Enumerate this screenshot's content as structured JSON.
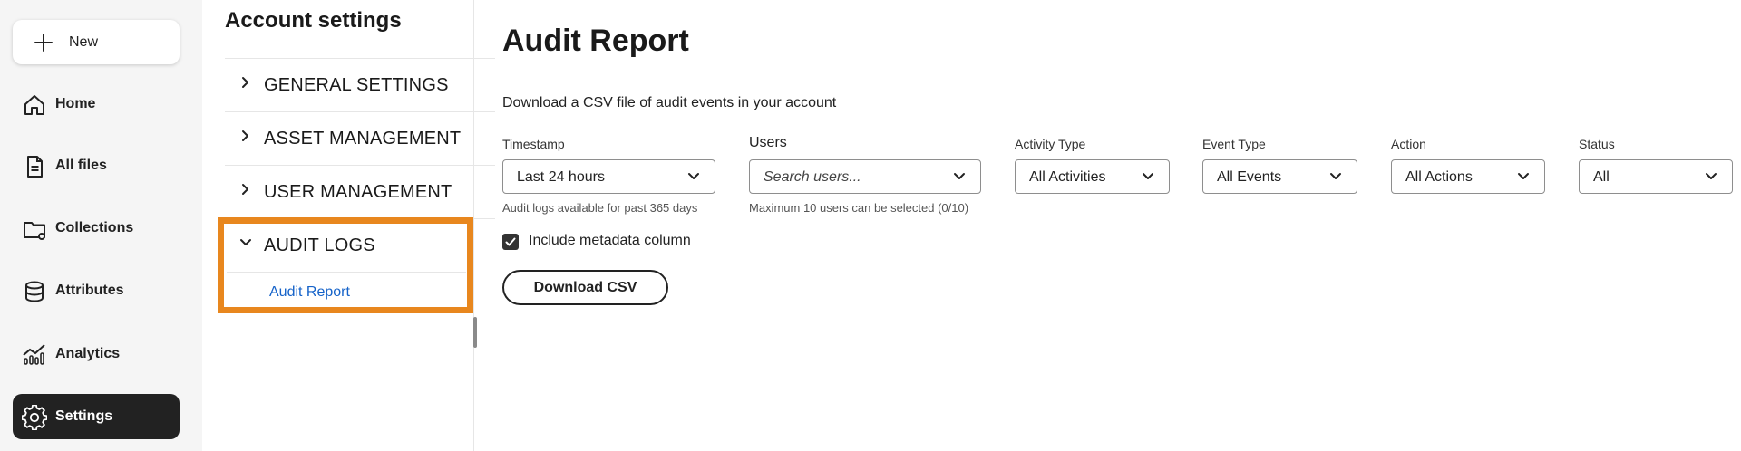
{
  "sidebar": {
    "new_label": "New",
    "items": [
      {
        "label": "Home",
        "icon": "home-icon"
      },
      {
        "label": "All files",
        "icon": "file-icon"
      },
      {
        "label": "Collections",
        "icon": "collections-folder-icon"
      },
      {
        "label": "Attributes",
        "icon": "database-icon"
      },
      {
        "label": "Analytics",
        "icon": "analytics-chart-icon"
      },
      {
        "label": "Settings",
        "icon": "gear-icon",
        "active": true
      }
    ]
  },
  "settings_panel": {
    "title": "Account settings",
    "sections": [
      {
        "label": "GENERAL SETTINGS",
        "expanded": false
      },
      {
        "label": "ASSET MANAGEMENT",
        "expanded": false
      },
      {
        "label": "USER MANAGEMENT",
        "expanded": false
      },
      {
        "label": "AUDIT LOGS",
        "expanded": true,
        "children": [
          "Audit Report"
        ]
      }
    ],
    "highlight_color": "#e8871e"
  },
  "main": {
    "title": "Audit Report",
    "description": "Download a CSV file of audit events in your account",
    "filters": {
      "timestamp": {
        "label": "Timestamp",
        "value": "Last 24 hours",
        "hint": "Audit logs available for past 365 days"
      },
      "users": {
        "label": "Users",
        "placeholder": "Search users...",
        "hint": "Maximum 10 users can be selected (0/10)"
      },
      "activity_type": {
        "label": "Activity Type",
        "value": "All Activities"
      },
      "event_type": {
        "label": "Event Type",
        "value": "All Events"
      },
      "action": {
        "label": "Action",
        "value": "All Actions"
      },
      "status": {
        "label": "Status",
        "value": "All"
      }
    },
    "include_metadata": {
      "label": "Include metadata column",
      "checked": true
    },
    "download_button": "Download CSV"
  },
  "colors": {
    "active_nav_bg": "#222222",
    "link": "#1663c9",
    "accent_outline": "#e8871e"
  }
}
